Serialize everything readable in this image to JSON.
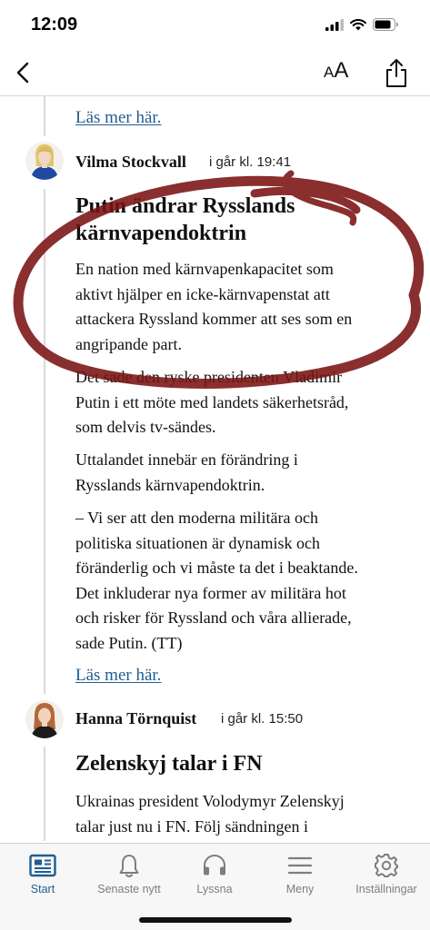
{
  "status_bar": {
    "time": "12:09"
  },
  "nav": {
    "font_size_label_small": "A",
    "font_size_label_big": "A"
  },
  "prev_entry": {
    "read_more": "Läs mer här."
  },
  "entries": [
    {
      "author": "Vilma Stockvall",
      "time": "i går kl. 19:41",
      "headline_line1": "Putin ändrar Rysslands",
      "headline_line2": "kärnvapendoktrin",
      "paragraphs": [
        [
          "En nation med kärnvapenkapacitet som",
          "aktivt hjälper en icke-kärnvapenstat att",
          "attackera Ryssland kommer att ses som en",
          "angripande part."
        ],
        [
          "Det sade den ryske presidenten Vladimir",
          "Putin i ett möte med landets säkerhetsråd,",
          "som delvis tv-sändes."
        ],
        [
          "Uttalandet innebär en förändring i",
          "Rysslands kärnvapendoktrin."
        ],
        [
          "– Vi ser att den moderna militära och",
          "politiska situationen är dynamisk och",
          "föränderlig och vi måste ta det i beaktande.",
          "Det inkluderar nya former av militära hot",
          "och risker för Ryssland och våra allierade,",
          "sade Putin. (TT)"
        ]
      ],
      "read_more": "Läs mer här."
    },
    {
      "author": "Hanna Törnquist",
      "time": "i går kl. 15:50",
      "headline": "Zelenskyj talar i FN",
      "paragraph_lines": [
        "Ukrainas president Volodymyr Zelenskyj",
        "talar just nu i FN. Följ sändningen i"
      ]
    }
  ],
  "tab_bar": {
    "tabs": [
      {
        "label": "Start",
        "icon": "newspaper-icon",
        "active": true
      },
      {
        "label": "Senaste nytt",
        "icon": "bell-icon",
        "active": false
      },
      {
        "label": "Lyssna",
        "icon": "headphones-icon",
        "active": false
      },
      {
        "label": "Meny",
        "icon": "menu-icon",
        "active": false
      },
      {
        "label": "Inställningar",
        "icon": "gear-icon",
        "active": false
      }
    ]
  },
  "colors": {
    "link": "#1f5d8f",
    "annotation_stroke": "#7a1212",
    "active_tab": "#1f5d8f"
  }
}
